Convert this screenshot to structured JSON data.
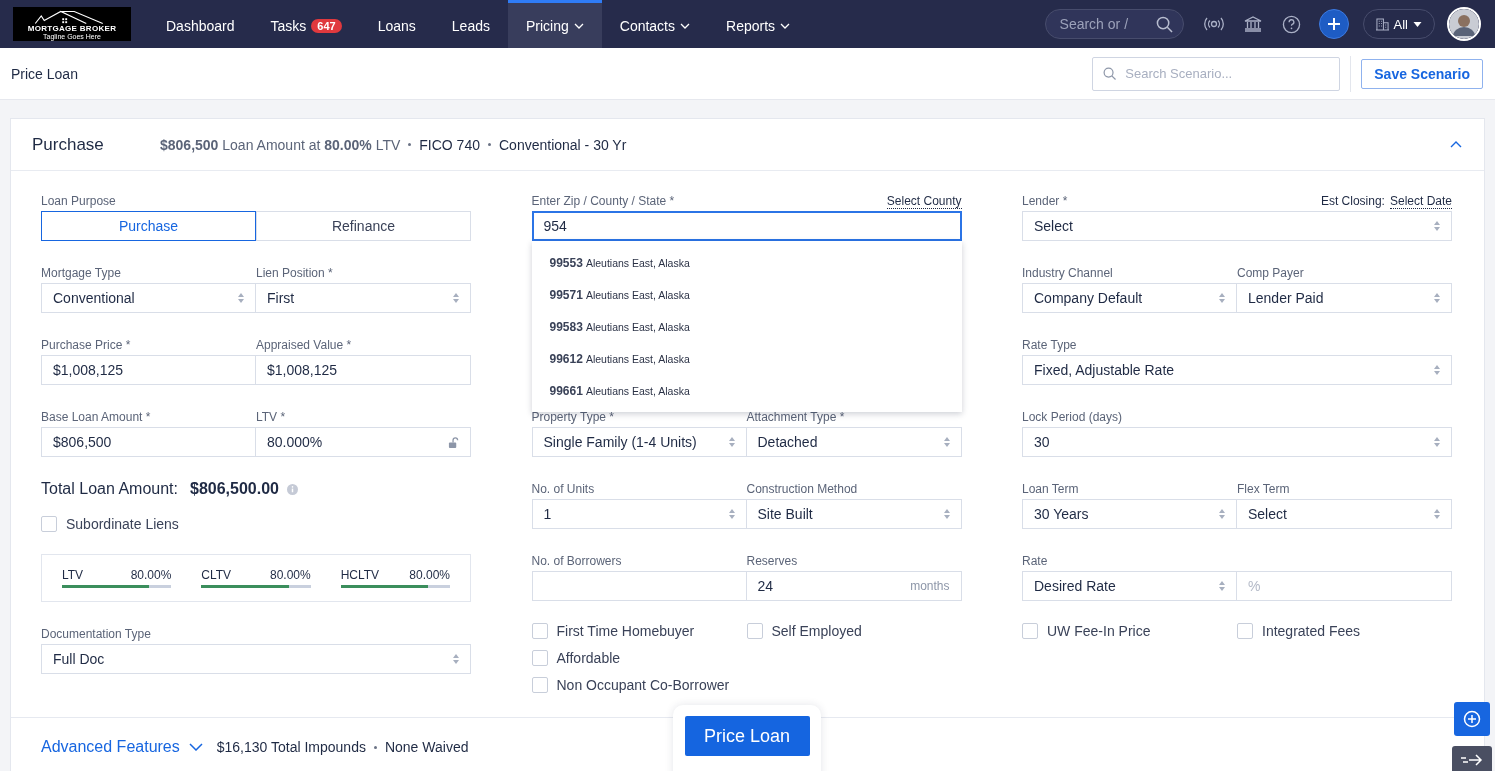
{
  "nav": {
    "logo": {
      "title": "MORTGAGE BROKER",
      "tagline": "Tagline Goes Here"
    },
    "items": [
      {
        "label": "Dashboard",
        "selected": false,
        "dropdown": false
      },
      {
        "label": "Tasks",
        "badge": "647",
        "selected": false,
        "dropdown": false
      },
      {
        "label": "Loans",
        "selected": false,
        "dropdown": false
      },
      {
        "label": "Leads",
        "selected": false,
        "dropdown": false
      },
      {
        "label": "Pricing",
        "selected": true,
        "dropdown": true
      },
      {
        "label": "Contacts",
        "selected": false,
        "dropdown": true
      },
      {
        "label": "Reports",
        "selected": false,
        "dropdown": true
      }
    ],
    "search": {
      "placeholder": "Search or /"
    },
    "scope": {
      "label": "All"
    }
  },
  "page_header": {
    "title": "Price Loan",
    "search": {
      "placeholder": "Search Scenario..."
    },
    "save_button": "Save Scenario"
  },
  "summary": {
    "title": "Purchase",
    "text": "**$806,500** Loan Amount at **80.00%** LTV",
    "items": [
      "FICO 740",
      "Conventional - 30 Yr"
    ],
    "expanded": true
  },
  "form": {
    "columns": [
      {
        "rows": [
          {
            "kind": "segmented",
            "label": "Loan Purpose",
            "options": [
              {
                "label": "Purchase",
                "selected": true
              },
              {
                "label": "Refinance",
                "selected": false
              }
            ]
          },
          {
            "kind": "fields",
            "fields": [
              {
                "kind": "select",
                "label": "Mortgage Type",
                "value": "Conventional"
              },
              {
                "kind": "select",
                "label": "Lien Position *",
                "value": "First"
              }
            ]
          },
          {
            "kind": "fields",
            "fields": [
              {
                "kind": "input",
                "label": "Purchase Price *",
                "value": "$1,008,125"
              },
              {
                "kind": "input",
                "label": "Appraised Value *",
                "value": "$1,008,125"
              }
            ]
          },
          {
            "kind": "fields",
            "fields": [
              {
                "kind": "input",
                "label": "Base Loan Amount *",
                "value": "$806,500"
              },
              {
                "kind": "input",
                "label": "LTV *",
                "value": "80.000%",
                "locked": false
              }
            ]
          },
          {
            "kind": "total",
            "label": "Total Loan Amount:",
            "value": "$806,500.00"
          },
          {
            "kind": "checkboxes",
            "groups": [
              {
                "items": [
                  {
                    "label": "Subordinate Liens",
                    "checked": false
                  }
                ]
              }
            ]
          },
          {
            "kind": "ratios",
            "items": [
              {
                "label": "LTV",
                "value": "80.00%",
                "level": 0.8
              },
              {
                "label": "CLTV",
                "value": "80.00%",
                "level": 0.8
              },
              {
                "label": "HCLTV",
                "value": "80.00%",
                "level": 0.8
              }
            ]
          },
          {
            "kind": "fields",
            "fields": [
              {
                "kind": "select",
                "label": "Documentation Type",
                "value": "Full Doc"
              }
            ]
          }
        ]
      },
      {
        "rows": [
          {
            "kind": "fields",
            "fields": [
              {
                "kind": "input",
                "label": "Enter Zip / County / State *",
                "value": "954",
                "focused": true,
                "aside": {
                  "link": "Select County"
                },
                "suggestions": [
                  {
                    "zip": "**9**9553",
                    "place": "Aleutians East, Alaska"
                  },
                  {
                    "zip": "**9**9571",
                    "place": "Aleutians East, Alaska"
                  },
                  {
                    "zip": "**9**9583",
                    "place": "Aleutians East, Alaska"
                  },
                  {
                    "zip": "**9**9612",
                    "place": "Aleutians East, Alaska"
                  },
                  {
                    "zip": "**9**9661",
                    "place": "Aleutians East, Alaska"
                  }
                ]
              }
            ]
          },
          {
            "kind": "fields",
            "fields": [
              {
                "kind": "select",
                "label": "Property Type *",
                "value": "Single Family (1-4 Units)"
              },
              {
                "kind": "select",
                "label": "Attachment Type *",
                "value": "Detached"
              }
            ]
          },
          {
            "kind": "fields",
            "fields": [
              {
                "kind": "select",
                "label": "No. of Units",
                "value": "1"
              },
              {
                "kind": "select",
                "label": "Construction Method",
                "value": "Site Built"
              }
            ]
          },
          {
            "kind": "fields",
            "fields": [
              {
                "kind": "input",
                "label": "No. of Borrowers"
              },
              {
                "kind": "input",
                "label": "Reserves",
                "value": "24",
                "suffix": "months"
              }
            ]
          },
          {
            "kind": "checkboxes",
            "groups": [
              {
                "items": [
                  {
                    "label": "First Time Homebuyer",
                    "checked": false
                  },
                  {
                    "label": "Affordable",
                    "checked": false
                  },
                  {
                    "label": "Non Occupant Co-Borrower",
                    "checked": false
                  }
                ]
              },
              {
                "items": [
                  {
                    "label": "Self Employed",
                    "checked": false
                  }
                ]
              }
            ]
          }
        ]
      },
      {
        "rows": [
          {
            "kind": "fields",
            "fields": [
              {
                "kind": "select",
                "label": "Lender *",
                "value": "Select",
                "aside": {
                  "label": "Est Closing:",
                  "link": "Select Date"
                }
              }
            ]
          },
          {
            "kind": "fields",
            "fields": [
              {
                "kind": "select",
                "label": "Industry Channel",
                "value": "Company Default"
              },
              {
                "kind": "select",
                "label": "Comp Payer",
                "value": "Lender Paid"
              }
            ]
          },
          {
            "kind": "fields",
            "fields": [
              {
                "kind": "select",
                "label": "Rate Type",
                "value": "Fixed, Adjustable Rate"
              }
            ]
          },
          {
            "kind": "fields",
            "fields": [
              {
                "kind": "select",
                "label": "Lock Period (days)",
                "value": "30"
              }
            ]
          },
          {
            "kind": "fields",
            "fields": [
              {
                "kind": "select",
                "label": "Loan Term",
                "value": "30 Years"
              },
              {
                "kind": "select",
                "label": "Flex Term",
                "value": "Select"
              }
            ]
          },
          {
            "kind": "fields",
            "fields": [
              {
                "kind": "select",
                "label": "Rate",
                "value": "Desired Rate"
              },
              {
                "kind": "input",
                "placeholder": "%"
              }
            ]
          },
          {
            "kind": "checkboxes",
            "groups": [
              {
                "items": [
                  {
                    "label": "UW Fee-In Price",
                    "checked": false
                  }
                ]
              },
              {
                "items": [
                  {
                    "label": "Integrated Fees",
                    "checked": false
                  }
                ]
              }
            ]
          }
        ]
      }
    ]
  },
  "advanced": {
    "label": "Advanced Features",
    "expanded": false,
    "items": [
      "$16,130 Total Impounds",
      "None Waived"
    ]
  },
  "price_button": "Price Loan"
}
